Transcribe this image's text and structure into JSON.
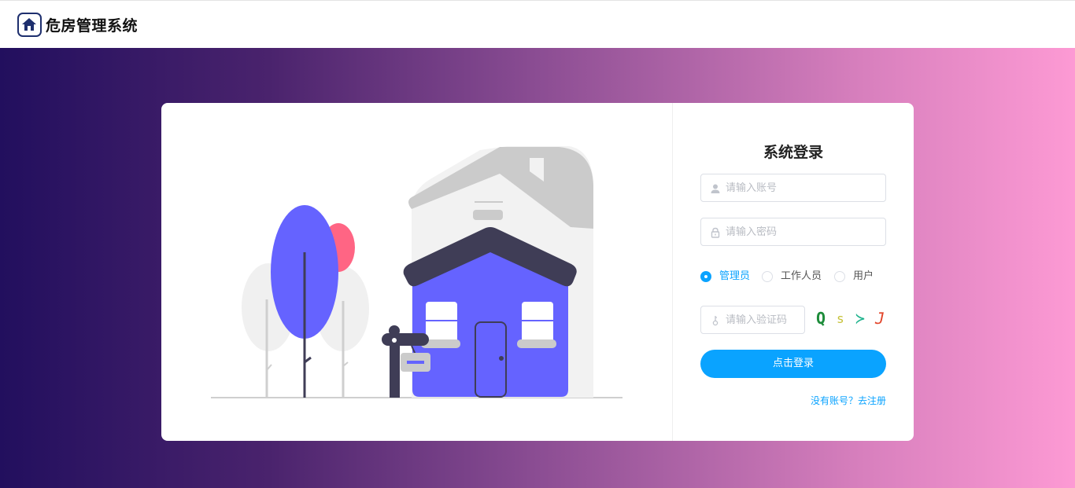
{
  "header": {
    "app_title": "危房管理系统",
    "logo_icon": "house-icon"
  },
  "login": {
    "title": "系统登录",
    "account_placeholder": "请输入账号",
    "password_placeholder": "请输入密码",
    "roles": [
      {
        "label": "管理员",
        "selected": true
      },
      {
        "label": "工作人员",
        "selected": false
      },
      {
        "label": "用户",
        "selected": false
      }
    ],
    "captcha_placeholder": "请输入验证码",
    "captcha_chars": [
      {
        "char": "Q",
        "color": "#1d8c3a"
      },
      {
        "char": "s",
        "color": "#c7c23a"
      },
      {
        "char": "≻",
        "color": "#1fb38d"
      },
      {
        "char": "J",
        "color": "#e2452a"
      }
    ],
    "submit_label": "点击登录",
    "register_link": "没有账号？去注册"
  },
  "colors": {
    "accent": "#0aa3ff",
    "gradient_start": "#220f5e",
    "gradient_end": "#fd9ad4",
    "house_blue": "#6563ff",
    "roof_dark": "#3f3d56"
  }
}
